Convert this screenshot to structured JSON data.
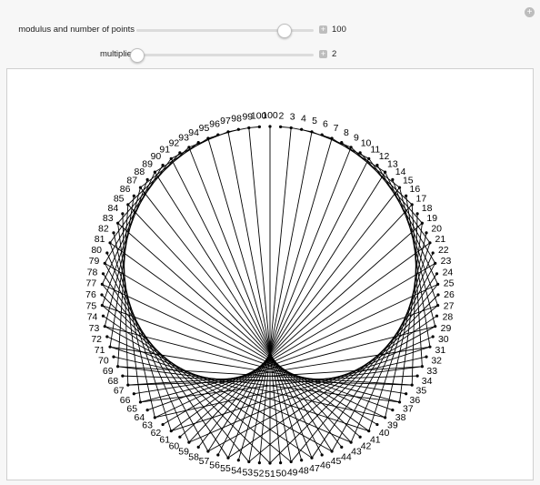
{
  "controls": [
    {
      "label": "modulus and number of points",
      "value": 100,
      "min": 2,
      "max": 120
    },
    {
      "label": "multiplier",
      "value": 2,
      "min": 2,
      "max": 50
    }
  ],
  "figure": {
    "modulus": 100,
    "multiplier": 2,
    "points_labels_start": 1,
    "top_label": "100"
  },
  "colors": {
    "panel_bg": "#f7f7f7",
    "canvas_bg": "#ffffff",
    "line": "#000000",
    "accent": "#bdbdbd"
  },
  "icons": {
    "reset": "reset-icon",
    "plus": "plus-icon"
  }
}
